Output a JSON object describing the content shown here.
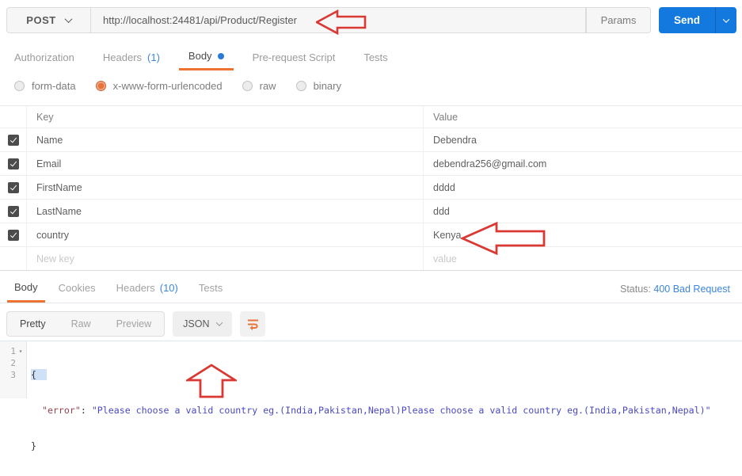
{
  "request_bar": {
    "method": "POST",
    "url": "http://localhost:24481/api/Product/Register",
    "params_label": "Params",
    "send_label": "Send"
  },
  "request_tabs": {
    "authorization": "Authorization",
    "headers": "Headers",
    "headers_count": "(1)",
    "body": "Body",
    "prerequest": "Pre-request Script",
    "tests": "Tests"
  },
  "body_modes": {
    "form_data": "form-data",
    "urlencoded": "x-www-form-urlencoded",
    "raw": "raw",
    "binary": "binary",
    "selected": "x-www-form-urlencoded"
  },
  "kv_table": {
    "key_header": "Key",
    "value_header": "Value",
    "rows": [
      {
        "key": "Name",
        "value": "Debendra",
        "checked": true
      },
      {
        "key": "Email",
        "value": "debendra256@gmail.com",
        "checked": true
      },
      {
        "key": "FirstName",
        "value": "dddd",
        "checked": true
      },
      {
        "key": "LastName",
        "value": "ddd",
        "checked": true
      },
      {
        "key": "country",
        "value": "Kenya",
        "checked": true
      }
    ],
    "new_key_placeholder": "New key",
    "new_value_placeholder": "value"
  },
  "response": {
    "tabs": {
      "body": "Body",
      "cookies": "Cookies",
      "headers": "Headers",
      "headers_count": "(10)",
      "tests": "Tests"
    },
    "status_label": "Status:",
    "status_value": "400 Bad Request",
    "toolbar": {
      "pretty": "Pretty",
      "raw": "Raw",
      "preview": "Preview",
      "format": "JSON"
    },
    "code": {
      "line_numbers": [
        "1",
        "2",
        "3"
      ],
      "line1": "{",
      "line2_indent": "  ",
      "line2_key": "\"error\"",
      "line2_colon": ": ",
      "line2_value": "\"Please choose a valid country eg.(India,Pakistan,Nepal)Please choose a valid country eg.(India,Pakistan,Nepal)\"",
      "line3": "}"
    }
  },
  "colors": {
    "accent_orange": "#ee7333",
    "accent_blue": "#3c86dd",
    "send_blue": "#1479de",
    "arrow_red": "#da3832",
    "json_key": "#96424e",
    "json_string": "#4b4ac2"
  }
}
